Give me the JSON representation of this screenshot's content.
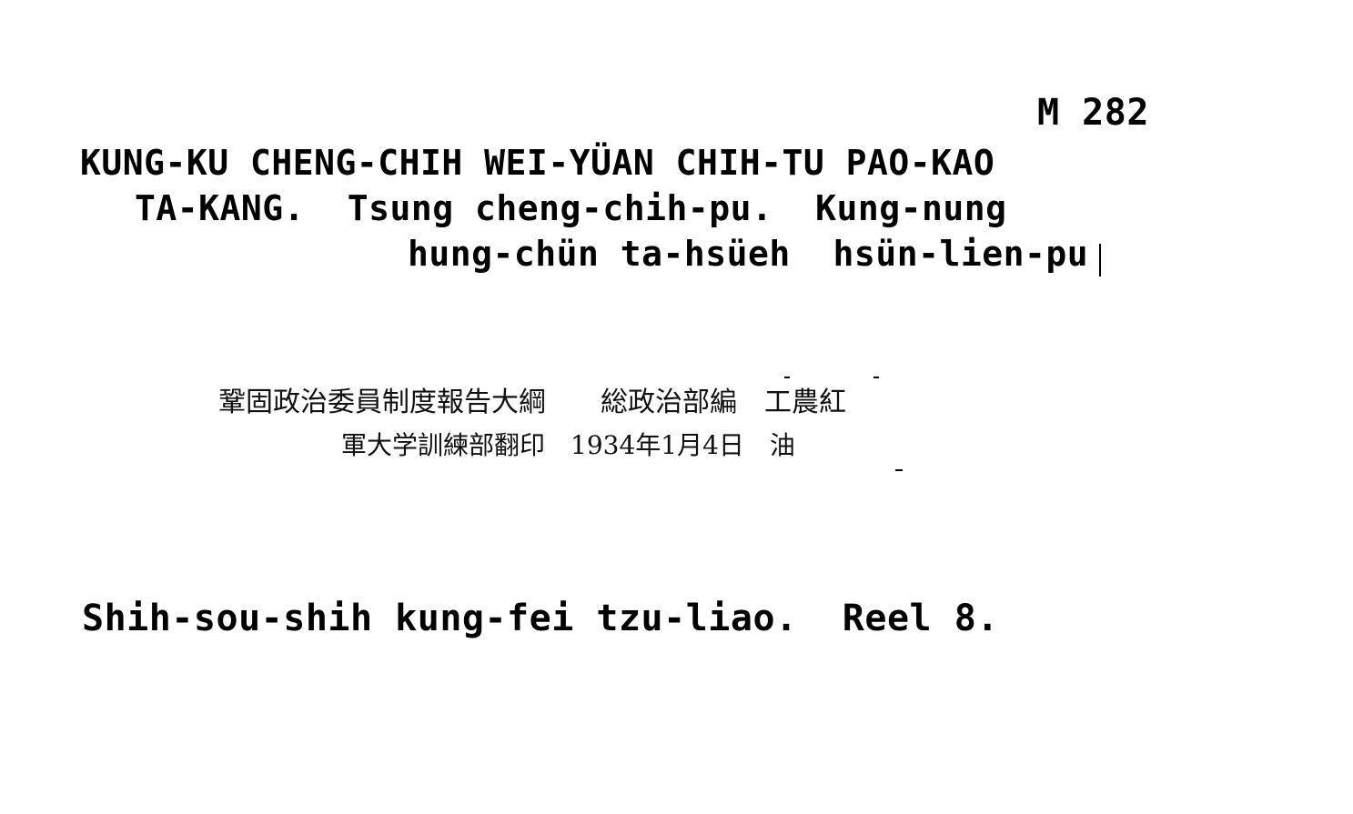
{
  "card": {
    "call_number": "M 282",
    "title_lines": [
      "KUNG-KU CHENG-CHIH WEI-YÜAN CHIH-TU PAO-KAO",
      "TA-KANG.  Tsung cheng-chih-pu.  Kung-nung",
      "hung-chün ta-hsüeh  hsün-lien-pu"
    ],
    "chinese_lines": [
      "鞏固政治委員制度報告大綱　　総政治部編　工農紅",
      "軍大学訓練部翻印　1934年1月4日　油"
    ],
    "series": "Shih-sou-shih kung-fei tzu-liao.  Reel 8."
  }
}
